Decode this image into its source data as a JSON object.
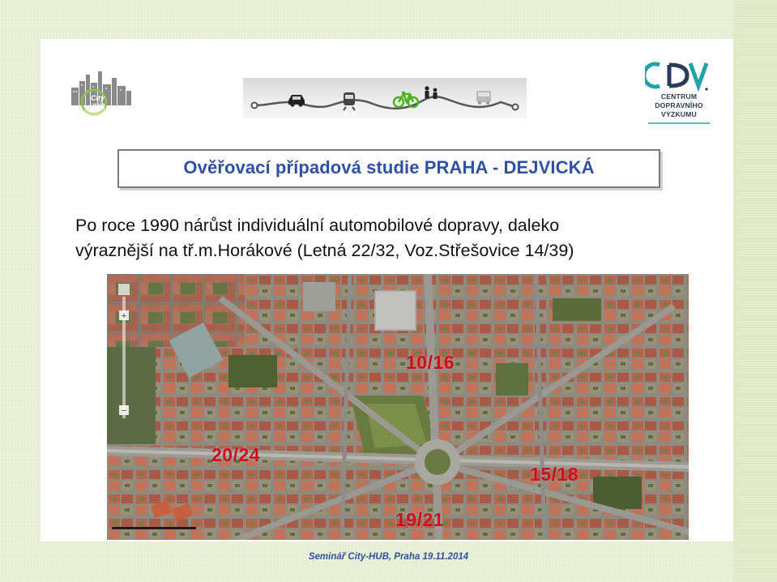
{
  "slide": {
    "title": "Ověřovací případová studie PRAHA - DEJVICKÁ",
    "body_line_1": "Po roce 1990 nárůst individuální automobilové dopravy, daleko",
    "body_line_2": "výraznější na tř.m.Horákové (Letná 22/32, Voz.Střešovice 14/39)",
    "footer": "Seminář City-HUB, Praha 19.11.2014"
  },
  "logos": {
    "cityhub": {
      "line1": "City",
      "line2": "HUB"
    },
    "cdv": {
      "line1": "CENTRUM",
      "line2": "DOPRAVNÍHO",
      "line3": "VÝZKUMU"
    }
  },
  "map": {
    "labels": [
      {
        "text": "10/16"
      },
      {
        "text": "20/24"
      },
      {
        "text": "15/18"
      },
      {
        "text": "19/21"
      }
    ],
    "zoom_plus": "+",
    "zoom_minus": "−"
  },
  "colors": {
    "title": "#2f50a6",
    "label": "#cc0d1e",
    "cdv_teal": "#21a3a8",
    "cdv_dark": "#2b3a55",
    "bike_green": "#49b21d"
  },
  "icons": [
    "car-icon",
    "tram-icon",
    "bicycle-icon",
    "pedestrian-icon",
    "bus-icon"
  ]
}
